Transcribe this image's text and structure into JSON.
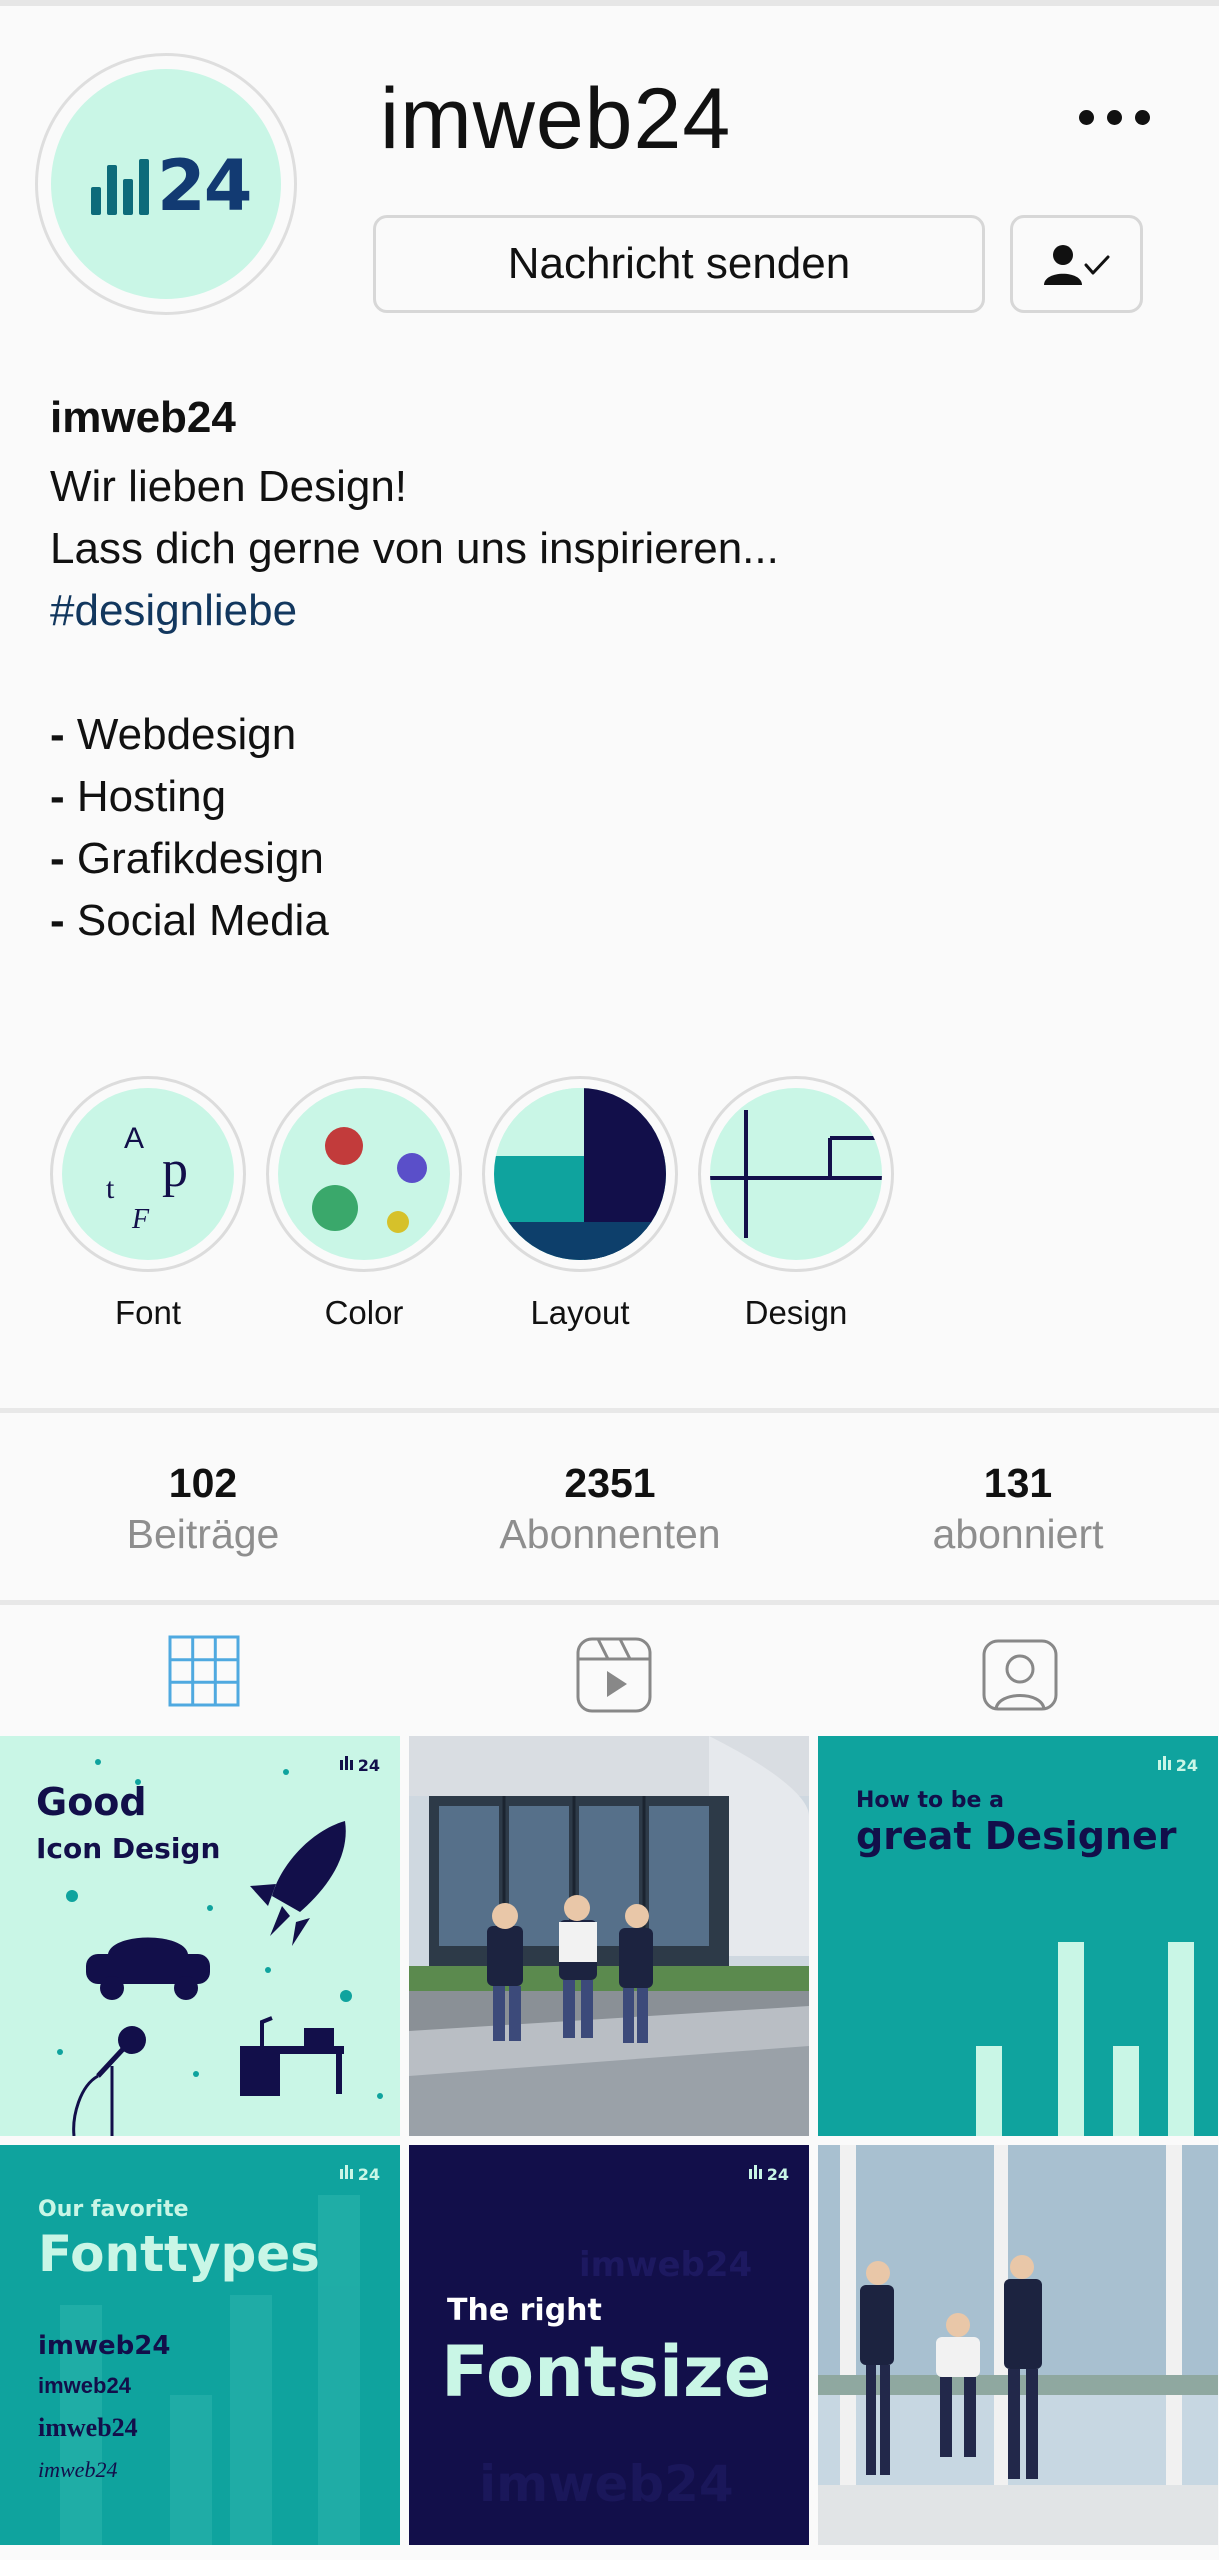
{
  "profile": {
    "username": "imweb24",
    "avatar_text": "24",
    "message_button": "Nachricht senden",
    "more_icon": "more-horizontal-icon",
    "follow_icon": "person-check-icon"
  },
  "bio": {
    "name": "imweb24",
    "line1": "Wir lieben Design!",
    "line2": "Lass dich gerne von uns inspirieren...",
    "hashtag": "#designliebe",
    "items": [
      "Webdesign",
      "Hosting",
      "Grafikdesign",
      "Social Media"
    ]
  },
  "highlights": [
    {
      "label": "Font"
    },
    {
      "label": "Color"
    },
    {
      "label": "Layout"
    },
    {
      "label": "Design"
    }
  ],
  "stats": [
    {
      "value": "102",
      "label": "Beiträge"
    },
    {
      "value": "2351",
      "label": "Abonnenten"
    },
    {
      "value": "131",
      "label": "abonniert"
    }
  ],
  "tabs": [
    {
      "icon": "grid-icon",
      "active": true
    },
    {
      "icon": "reels-icon",
      "active": false
    },
    {
      "icon": "tagged-icon",
      "active": false
    }
  ],
  "posts": {
    "p1": {
      "line1": "Good",
      "line2": "Icon Design",
      "brand": "24"
    },
    "p3": {
      "line1": "How to be a",
      "line2": "great Designer",
      "brand": "24"
    },
    "p4": {
      "line1": "Our favorite",
      "line2": "Fonttypes",
      "f1": "imweb24",
      "f2": "imweb24",
      "f3": "imweb24",
      "f4": "imweb24",
      "brand": "24"
    },
    "p5": {
      "line1": "The right",
      "line2": "Fontsize",
      "brand": "24",
      "bg1": "imweb24",
      "bg2": "imweb24"
    }
  },
  "colors": {
    "mint": "#c9f6e6",
    "teal": "#0fa39e",
    "navy": "#120f4a",
    "link": "#12375e",
    "tab_active": "#4fa9e0"
  }
}
